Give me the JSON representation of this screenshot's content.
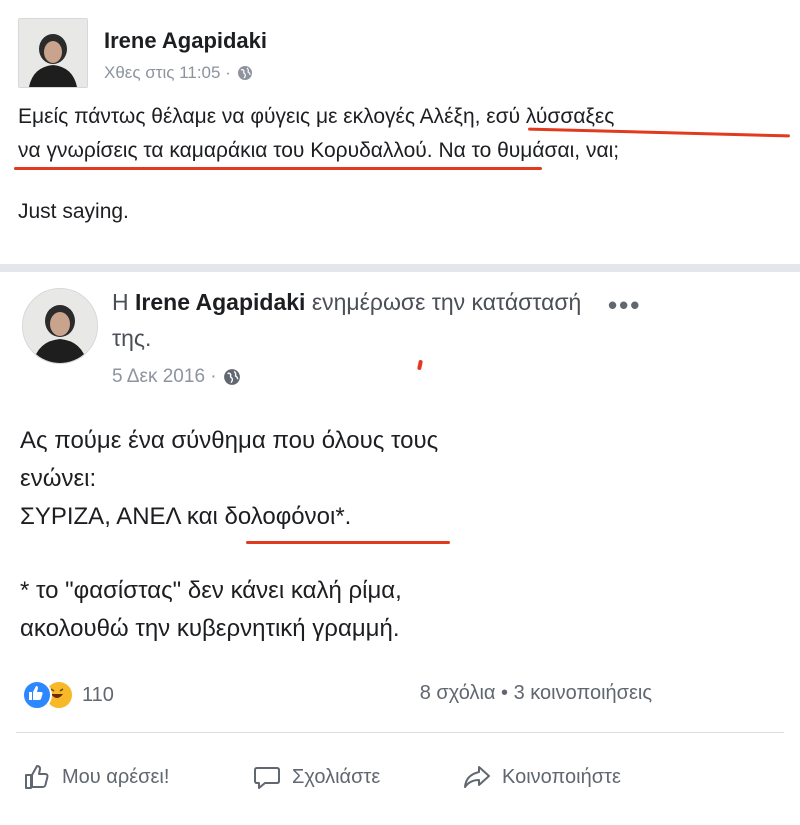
{
  "outer_post": {
    "author": "Irene Agapidaki",
    "timestamp": "Χθες στις 11:05 ·",
    "text_line1": "Εμείς πάντως θέλαμε να φύγεις με εκλογές Αλέξη, εσύ λύσσαξες",
    "text_line2": "να γνωρίσεις τα καμαράκια του Κορυδαλλού. Να το θυμάσαι, ναι;",
    "text_line3": "Just saying."
  },
  "shared_post": {
    "prefix": "Η",
    "author": "Irene Agapidaki",
    "action_text": "ενημέρωσε την κατάστασή της.",
    "date": "5 Δεκ 2016 ·",
    "more": "•••",
    "body_line1": "Ας πούμε ένα σύνθημα που όλους τους",
    "body_line2": "ενώνει:",
    "body_line3": "ΣΥΡΙΖΑ, ΑΝΕΛ και δολοφόνοι*.",
    "footnote_line1": "* το \"φασίστας\" δεν κάνει καλή ρίμα,",
    "footnote_line2": "ακολουθώ την κυβερνητική γραμμή."
  },
  "engagement": {
    "reaction_count": "110",
    "comments_shares": "8 σχόλια • 3 κοινοποιήσεις"
  },
  "actions": {
    "like": "Μου αρέσει!",
    "comment": "Σχολιάστε",
    "share": "Κοινοποιήστε"
  },
  "icons": {
    "globe": "globe-icon",
    "like": "thumbs-up-icon",
    "comment": "speech-bubble-icon",
    "share": "share-arrow-icon",
    "reaction_like": "like-reaction-icon",
    "reaction_haha": "haha-reaction-icon"
  },
  "colors": {
    "underline": "#e23a1e",
    "like_blue": "#2d88ff",
    "haha_yellow": "#f7b928",
    "meta_gray": "#8d949e"
  }
}
